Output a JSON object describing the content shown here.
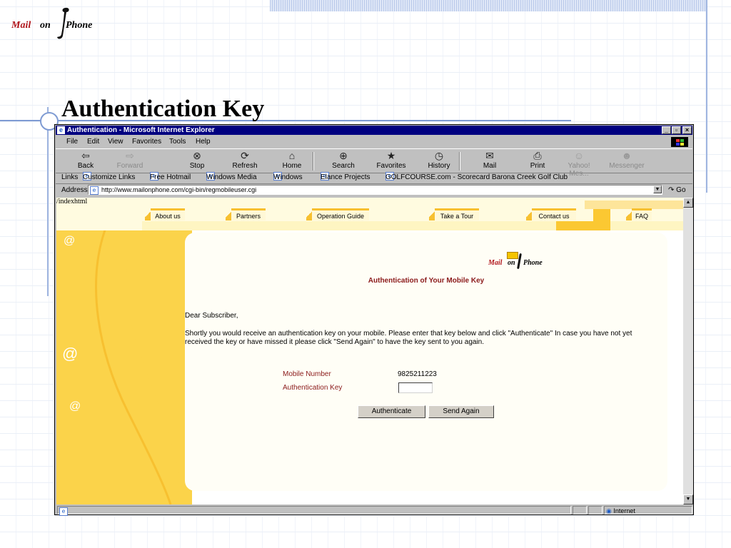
{
  "slide": {
    "title": "Authentication Key"
  },
  "logo": {
    "word1": "Mail",
    "word2": "on",
    "word3": "Phone"
  },
  "browser": {
    "title": "Authentication - Microsoft Internet Explorer",
    "window_buttons": [
      "_",
      "▫",
      "×"
    ],
    "menu": [
      "File",
      "Edit",
      "View",
      "Favorites",
      "Tools",
      "Help"
    ],
    "toolbar": [
      {
        "label": "Back",
        "icon": "back-arrow-icon",
        "glyph": "⇦",
        "enabled": true
      },
      {
        "label": "Forward",
        "icon": "forward-arrow-icon",
        "glyph": "⇨",
        "enabled": false
      },
      {
        "label": "Stop",
        "icon": "stop-icon",
        "glyph": "⊗",
        "enabled": true
      },
      {
        "label": "Refresh",
        "icon": "refresh-icon",
        "glyph": "⟳",
        "enabled": true
      },
      {
        "label": "Home",
        "icon": "home-icon",
        "glyph": "⌂",
        "enabled": true
      },
      {
        "label": "Search",
        "icon": "search-icon",
        "glyph": "⊕",
        "enabled": true
      },
      {
        "label": "Favorites",
        "icon": "favorites-icon",
        "glyph": "★",
        "enabled": true
      },
      {
        "label": "History",
        "icon": "history-icon",
        "glyph": "◷",
        "enabled": true
      },
      {
        "label": "Mail",
        "icon": "mail-icon",
        "glyph": "✉",
        "enabled": true
      },
      {
        "label": "Print",
        "icon": "print-icon",
        "glyph": "⎙",
        "enabled": true
      },
      {
        "label": "Yahoo! Mes...",
        "icon": "messenger-icon",
        "glyph": "☺",
        "enabled": false
      },
      {
        "label": "Messenger",
        "icon": "messenger-person-icon",
        "glyph": "☻",
        "enabled": false
      }
    ],
    "links_label": "Links",
    "links": [
      "Customize Links",
      "Free Hotmail",
      "Windows Media",
      "Windows",
      "Elance Projects",
      "GOLFCOURSE.com - Scorecard Barona Creek Golf Club"
    ],
    "address_label": "Address",
    "address_url": "http://www.mailonphone.com/cgi-bin/regmobileuser.cgi",
    "go_label": "Go",
    "status_zone": "Internet"
  },
  "page": {
    "url_fragment": "/indexhtml",
    "nav": [
      "About us",
      "Partners",
      "Operation Guide",
      "Take a Tour",
      "Contact us",
      "FAQ"
    ],
    "at_symbol": "@",
    "logo_word1": "Mail",
    "logo_word2": "on",
    "logo_word3": "Phone",
    "heading": "Authentication of Your Mobile Key",
    "greeting": "Dear Subscriber,",
    "paragraph": "Shortly you would receive an authentication key on your mobile. Please enter that key below and click \"Authenticate\" In case you have not yet received the key or have missed it please click \"Send Again\" to have the key sent to you again.",
    "mobile_label": "Mobile Number",
    "mobile_value": "9825211223",
    "key_label": "Authentication Key",
    "key_value": "",
    "authenticate_label": "Authenticate",
    "send_again_label": "Send Again"
  }
}
